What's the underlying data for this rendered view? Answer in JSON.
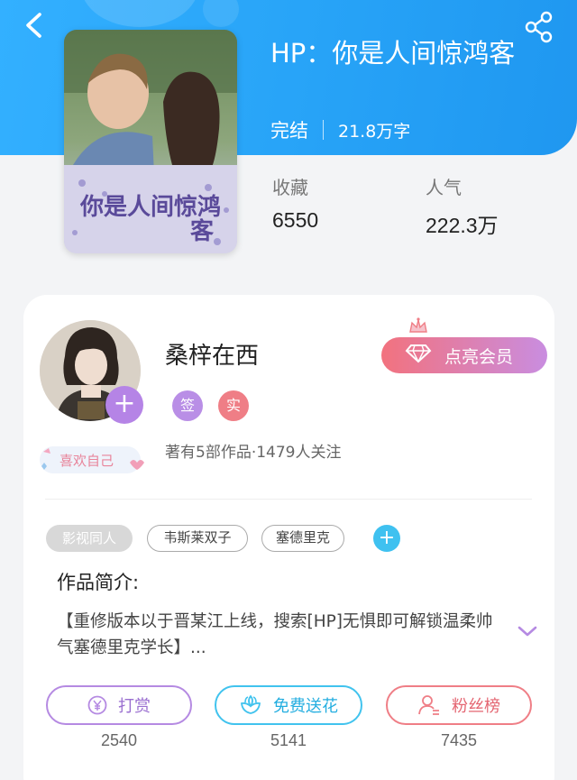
{
  "header": {
    "back_icon": "chevron-left-icon",
    "share_icon": "share-icon"
  },
  "book": {
    "title": "HP：你是人间惊鸿客",
    "status": "完结",
    "word_count": "21.8万字",
    "cover_image": "book-cover-art",
    "cover_title": "你是人间惊鸿",
    "cover_title_2": "客",
    "stats": [
      {
        "label": "收藏",
        "value": "6550"
      },
      {
        "label": "人气",
        "value": "222.3万"
      }
    ]
  },
  "author": {
    "name": "桑梓在西",
    "avatar": "author-avatar",
    "badges": [
      {
        "text": "签",
        "color": "#b98ee6"
      },
      {
        "text": "实",
        "color": "#ef7e86"
      }
    ],
    "summary": "著有5部作品·1479人关注",
    "like_self_label": "喜欢自己",
    "vip_button_label": "点亮会员"
  },
  "tags": [
    "影视同人",
    "韦斯莱双子",
    "塞德里克"
  ],
  "intro": {
    "heading": "作品简介:",
    "text": "【重修版本以于晋某江上线，搜索[HP]无惧即可解锁温柔帅气塞德里克学长】..."
  },
  "actions": [
    {
      "label": "打赏",
      "count": "2540",
      "icon": "yen-icon",
      "color": "#b58ae2"
    },
    {
      "label": "免费送花",
      "count": "5141",
      "icon": "flower-icon",
      "color": "#41c3ee"
    },
    {
      "label": "粉丝榜",
      "count": "7435",
      "icon": "user-icon",
      "color": "#ef7e86"
    }
  ]
}
